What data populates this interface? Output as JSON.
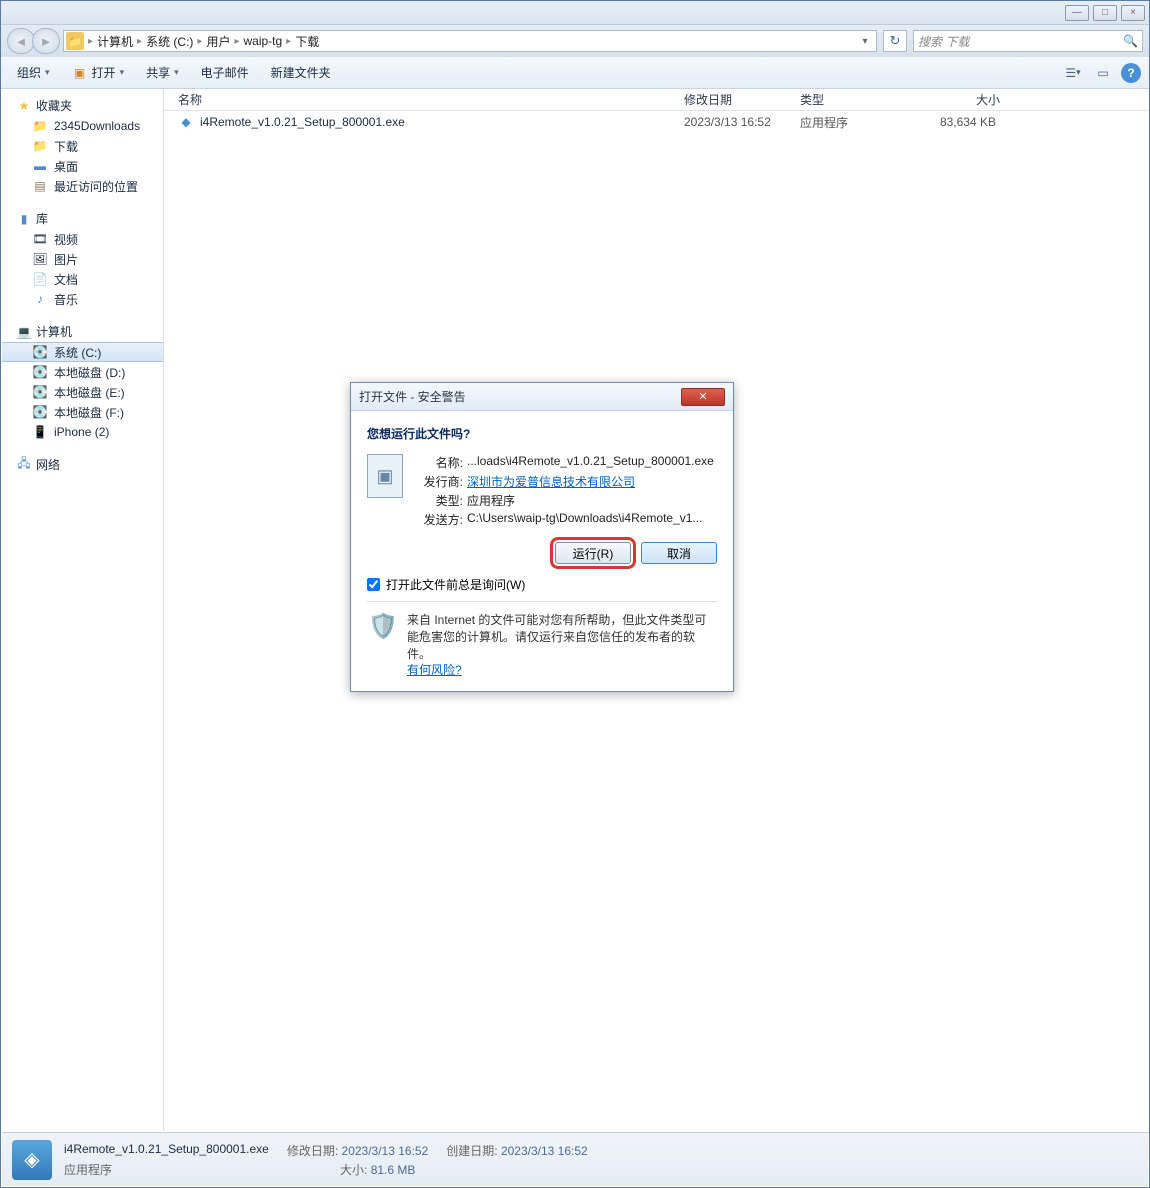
{
  "titlebar": {
    "min": "—",
    "max": "□",
    "close": "×"
  },
  "breadcrumb": {
    "segs": [
      "计算机",
      "系统 (C:)",
      "用户",
      "waip-tg",
      "下载"
    ]
  },
  "search": {
    "placeholder": "搜索 下载"
  },
  "toolbar": {
    "organize": "组织",
    "open": "打开",
    "share": "共享",
    "email": "电子邮件",
    "newfolder": "新建文件夹"
  },
  "sidebar": {
    "favorites": {
      "label": "收藏夹",
      "items": [
        "2345Downloads",
        "下载",
        "桌面",
        "最近访问的位置"
      ]
    },
    "libraries": {
      "label": "库",
      "items": [
        "视频",
        "图片",
        "文档",
        "音乐"
      ]
    },
    "computer": {
      "label": "计算机",
      "items": [
        "系统 (C:)",
        "本地磁盘 (D:)",
        "本地磁盘 (E:)",
        "本地磁盘 (F:)",
        "iPhone (2)"
      ]
    },
    "network": {
      "label": "网络"
    }
  },
  "columns": {
    "name": "名称",
    "date": "修改日期",
    "type": "类型",
    "size": "大小"
  },
  "file": {
    "name": "i4Remote_v1.0.21_Setup_800001.exe",
    "date": "2023/3/13 16:52",
    "type": "应用程序",
    "size": "83,634 KB"
  },
  "status": {
    "name": "i4Remote_v1.0.21_Setup_800001.exe",
    "type": "应用程序",
    "mod_label": "修改日期:",
    "mod": "2023/3/13 16:52",
    "size_label": "大小:",
    "size": "81.6 MB",
    "created_label": "创建日期:",
    "created": "2023/3/13 16:52"
  },
  "dialog": {
    "title": "打开文件 - 安全警告",
    "question": "您想运行此文件吗?",
    "labels": {
      "name": "名称:",
      "publisher": "发行商:",
      "type": "类型:",
      "from": "发送方:"
    },
    "values": {
      "name": "...loads\\i4Remote_v1.0.21_Setup_800001.exe",
      "publisher": "深圳市为爱普信息技术有限公司",
      "type": "应用程序",
      "from": "C:\\Users\\waip-tg\\Downloads\\i4Remote_v1..."
    },
    "run": "运行(R)",
    "cancel": "取消",
    "checkbox": "打开此文件前总是询问(W)",
    "warning": "来自 Internet 的文件可能对您有所帮助，但此文件类型可能危害您的计算机。请仅运行来自您信任的发布者的软件。",
    "risk_link": "有何风险?"
  }
}
